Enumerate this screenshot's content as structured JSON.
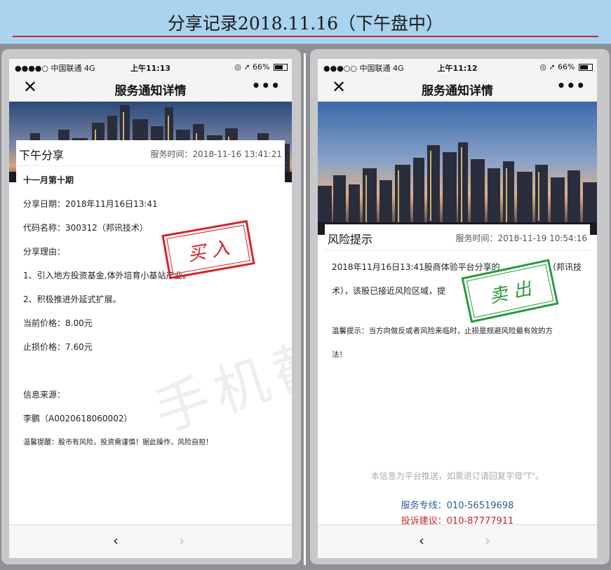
{
  "header": {
    "title": "分享记录2018.11.16（下午盘中）"
  },
  "watermark": "手机截图",
  "left_phone": {
    "status": {
      "carrier": "●●●●○ 中国联通  4G",
      "time": "上午11:13",
      "right": "◎ ➚ 66%"
    },
    "nav": {
      "close": "✕",
      "title": "服务通知详情",
      "more": "•••"
    },
    "card": {
      "title": "下午分享",
      "service_time": "服务时间：2018-11-16 13:41:21",
      "lines": [
        "十一月第十期",
        "分享日期：2018年11月16日13:41",
        "代码名称：300312（邦讯技术）",
        "分享理由：",
        "1、引入地方投资基金,体外培育小基站产业。",
        "2、积极推进外延式扩展。",
        "当前价格：8.00元",
        "止损价格：7.60元",
        "信息来源：",
        "李鹏（A0020618060002）",
        "温馨提醒：股市有风险，投资需谨慎！据此操作，风险自担！"
      ],
      "stamp": {
        "text": "买 入",
        "color": "#d8232a"
      }
    },
    "bottom": {
      "back": "‹",
      "forward": "›"
    }
  },
  "right_phone": {
    "status": {
      "carrier": "●●●○○ 中国联通  4G",
      "time": "上午11:12",
      "right": "◎ ➚ 66%"
    },
    "nav": {
      "close": "✕",
      "title": "服务通知详情",
      "more": "•••"
    },
    "card": {
      "title": "风险提示",
      "service_time": "服务时间：2018-11-19 10:54:16",
      "lines": [
        "2018年11月16日13:41股商体验平台分享的",
        "（邦讯技",
        "术），该股已接近风险区域，提",
        "温馨提示：当方向做反或者风险来临时，止损是规避风险最有效的方",
        "法！"
      ],
      "stamp": {
        "text": "卖 出",
        "color": "#2a9a3c"
      },
      "footer_note": "本信息为平台推送，如需退订请回复字母\"T\"。",
      "hotline": "服务专线：010-56519698",
      "complaint": "投诉建议：010-87777911"
    },
    "bottom": {
      "back": "‹",
      "forward": "›"
    }
  }
}
